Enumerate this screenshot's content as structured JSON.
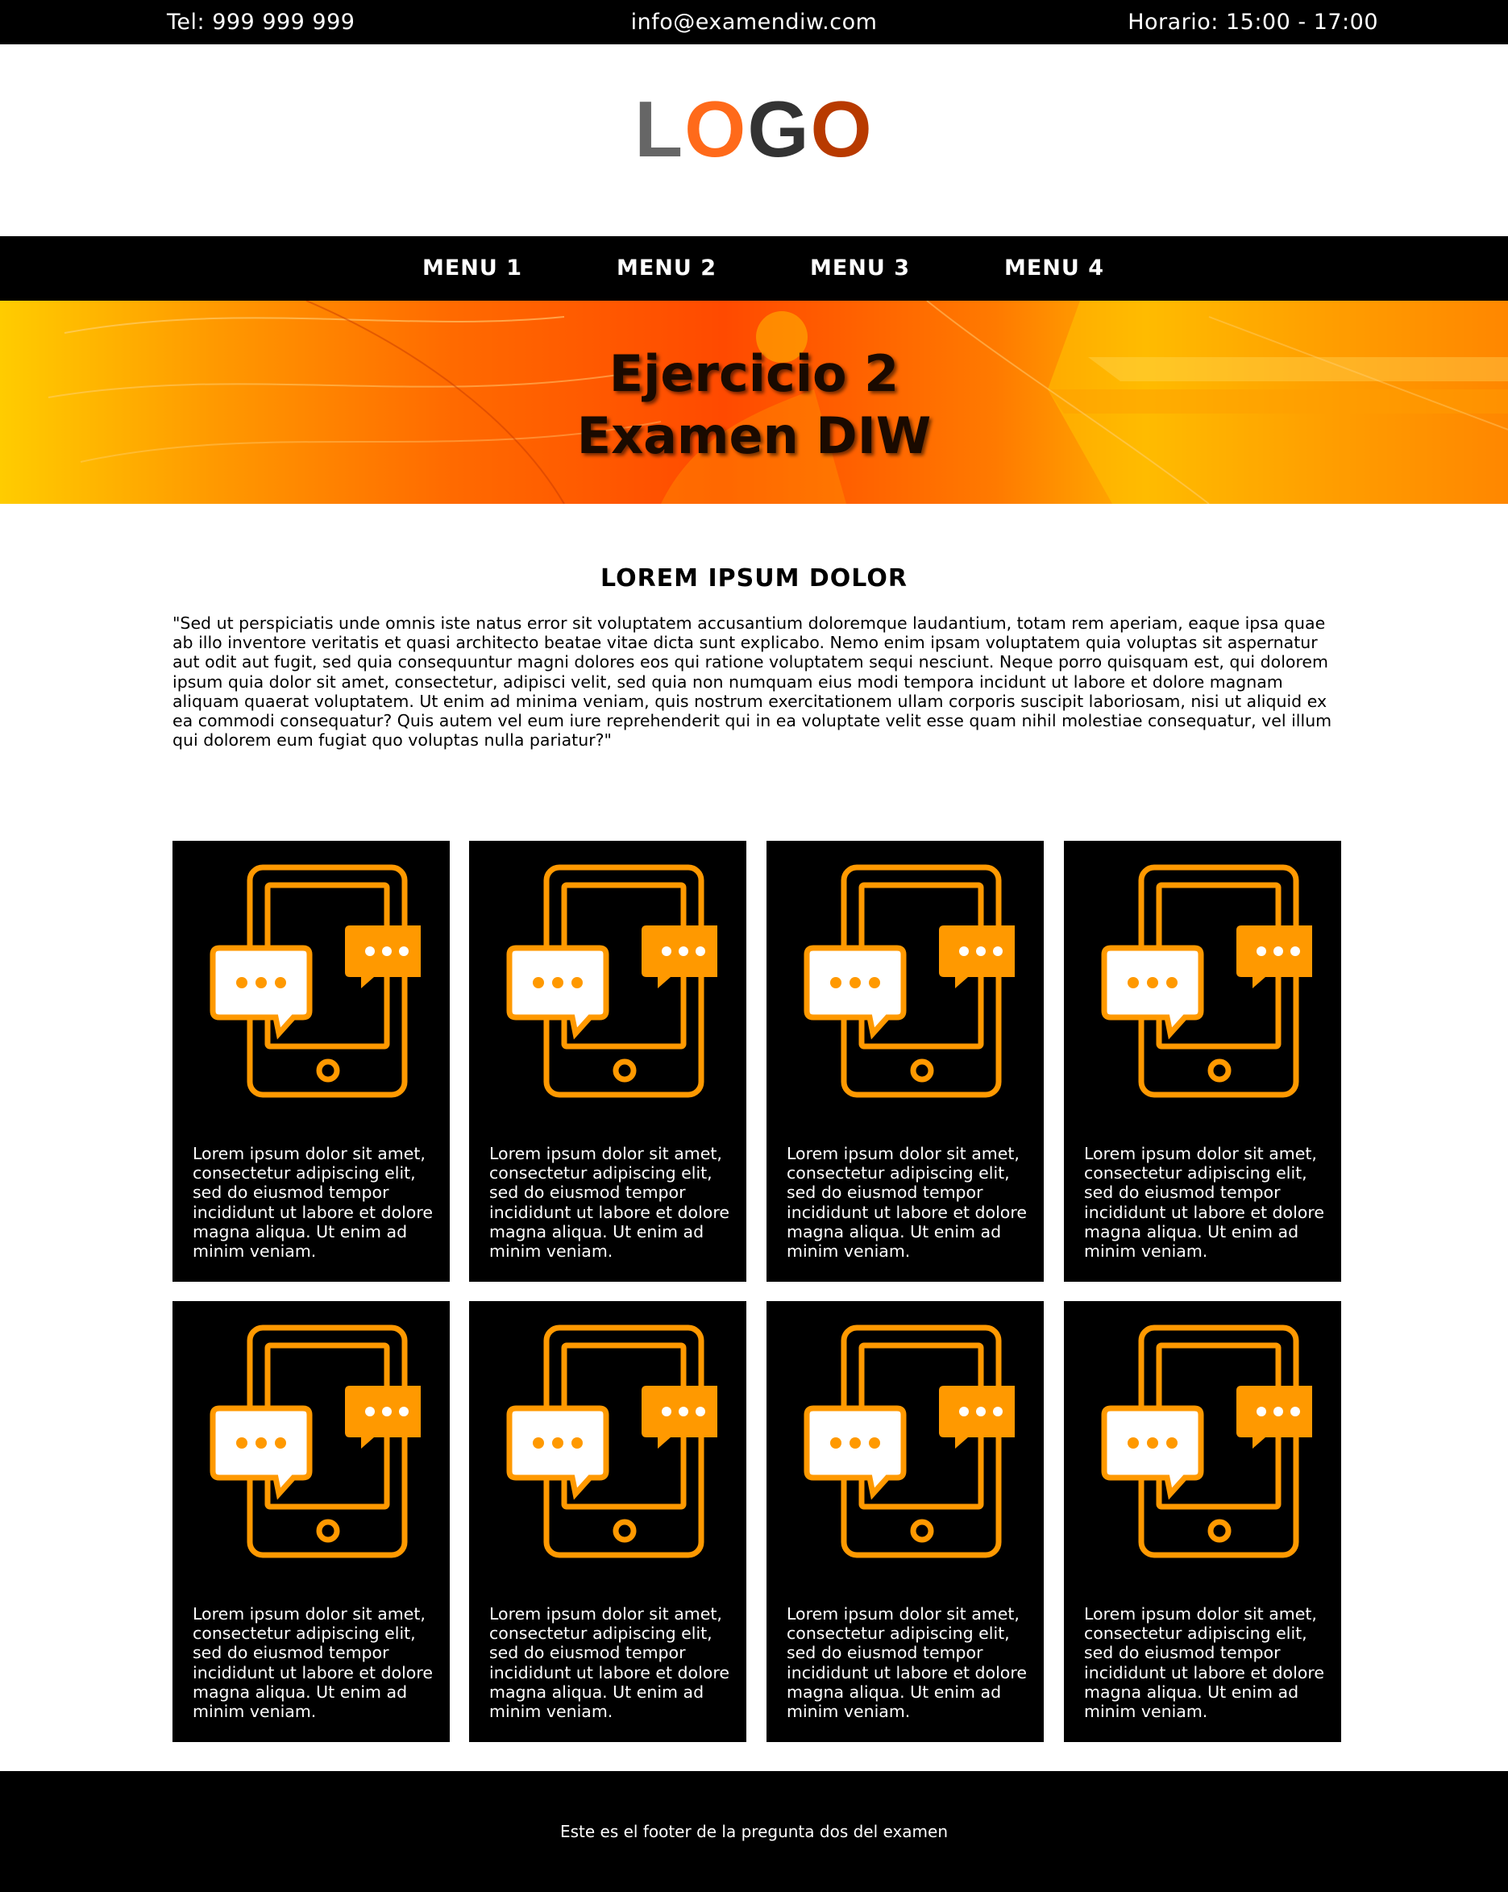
{
  "topbar": {
    "phone": "Tel: 999 999 999",
    "email": "info@examendiw.com",
    "hours": "Horario: 15:00 - 17:00"
  },
  "logo": {
    "letters": [
      "L",
      "O",
      "G",
      "O"
    ],
    "colors": [
      "#666666",
      "#ff6a1a",
      "#333333",
      "#b83a00"
    ]
  },
  "nav": {
    "items": [
      "MENU 1",
      "MENU 2",
      "MENU 3",
      "MENU 4"
    ]
  },
  "banner": {
    "title_line1": "Ejercicio 2",
    "title_line2": "Examen DIW"
  },
  "intro": {
    "heading": "LOREM IPSUM DOLOR",
    "text": "\"Sed ut perspiciatis unde omnis iste natus error sit voluptatem accusantium doloremque laudantium, totam rem aperiam, eaque ipsa quae ab illo inventore veritatis et quasi architecto beatae vitae dicta sunt explicabo. Nemo enim ipsam voluptatem quia voluptas sit aspernatur aut odit aut fugit, sed quia consequuntur magni dolores eos qui ratione voluptatem sequi nesciunt. Neque porro quisquam est, qui dolorem ipsum quia dolor sit amet, consectetur, adipisci velit, sed quia non numquam eius modi tempora incidunt ut labore et dolore magnam aliquam quaerat voluptatem. Ut enim ad minima veniam, quis nostrum exercitationem ullam corporis suscipit laboriosam, nisi ut aliquid ex ea commodi consequatur? Quis autem vel eum iure reprehenderit qui in ea voluptate velit esse quam nihil molestiae consequatur, vel illum qui dolorem eum fugiat quo voluptas nulla pariatur?\""
  },
  "cards": [
    {
      "icon": "phone-chat-icon",
      "text": "Lorem ipsum dolor sit amet, consectetur adipiscing elit, sed do eiusmod tempor incididunt ut labore et dolore magna aliqua. Ut enim ad minim veniam."
    },
    {
      "icon": "phone-chat-icon",
      "text": "Lorem ipsum dolor sit amet, consectetur adipiscing elit, sed do eiusmod tempor incididunt ut labore et dolore magna aliqua. Ut enim ad minim veniam."
    },
    {
      "icon": "phone-chat-icon",
      "text": "Lorem ipsum dolor sit amet, consectetur adipiscing elit, sed do eiusmod tempor incididunt ut labore et dolore magna aliqua. Ut enim ad minim veniam."
    },
    {
      "icon": "phone-chat-icon",
      "text": "Lorem ipsum dolor sit amet, consectetur adipiscing elit, sed do eiusmod tempor incididunt ut labore et dolore magna aliqua. Ut enim ad minim veniam."
    },
    {
      "icon": "phone-chat-icon",
      "text": "Lorem ipsum dolor sit amet, consectetur adipiscing elit, sed do eiusmod tempor incididunt ut labore et dolore magna aliqua. Ut enim ad minim veniam."
    },
    {
      "icon": "phone-chat-icon",
      "text": "Lorem ipsum dolor sit amet, consectetur adipiscing elit, sed do eiusmod tempor incididunt ut labore et dolore magna aliqua. Ut enim ad minim veniam."
    },
    {
      "icon": "phone-chat-icon",
      "text": "Lorem ipsum dolor sit amet, consectetur adipiscing elit, sed do eiusmod tempor incididunt ut labore et dolore magna aliqua. Ut enim ad minim veniam."
    },
    {
      "icon": "phone-chat-icon",
      "text": "Lorem ipsum dolor sit amet, consectetur adipiscing elit, sed do eiusmod tempor incididunt ut labore et dolore magna aliqua. Ut enim ad minim veniam."
    }
  ],
  "footer": {
    "text": "Este es el footer de la pregunta dos del examen"
  },
  "colors": {
    "icon_orange": "#ff9900",
    "background_dark": "#000000"
  }
}
